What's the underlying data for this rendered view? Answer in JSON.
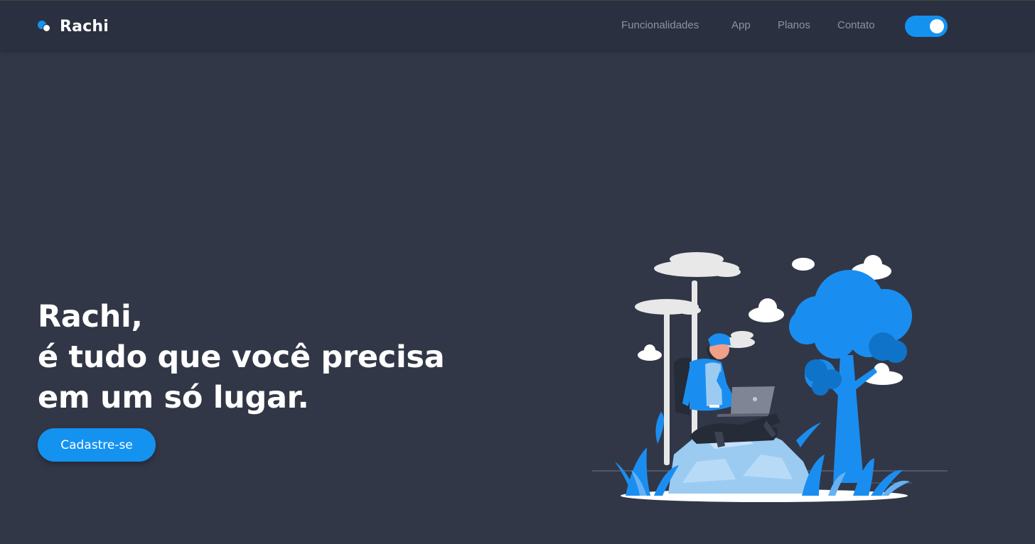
{
  "brand": {
    "name": "Rachi"
  },
  "nav": {
    "links": [
      {
        "label": "Funcionalidades"
      },
      {
        "label": "App"
      },
      {
        "label": "Planos"
      },
      {
        "label": "Contato"
      }
    ],
    "theme_toggle": {
      "state": "on"
    }
  },
  "hero": {
    "title_lines": [
      "Rachi,",
      "é tudo que você precisa",
      "em um só lugar."
    ],
    "cta_label": "Cadastre-se"
  },
  "colors": {
    "background": "#323747",
    "navbar": "#2a3040",
    "accent": "#1492f0",
    "nav_text": "#8b92a3",
    "text": "#ffffff"
  },
  "illustration": {
    "icons": [
      "person-with-laptop-icon",
      "tree-icon",
      "cloud-icon",
      "rock-icon",
      "plant-icon"
    ]
  }
}
